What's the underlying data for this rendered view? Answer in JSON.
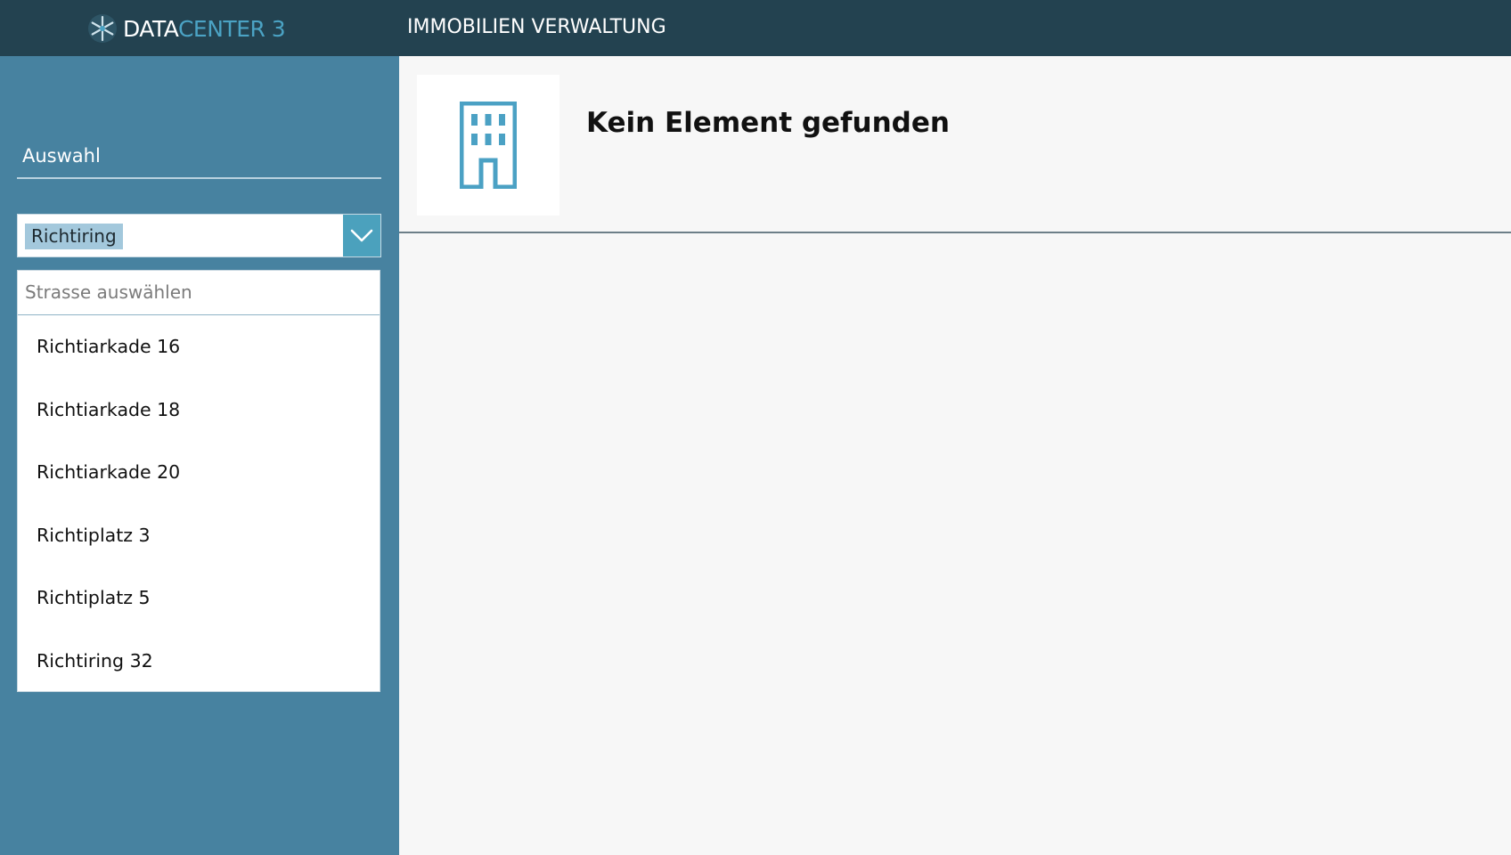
{
  "header": {
    "logo_text_primary": "DATA",
    "logo_text_accent": "CENTER 3",
    "app_title": "IMMOBILIEN VERWALTUNG"
  },
  "sidebar": {
    "section_title": "Auswahl",
    "combo": {
      "selected_value": "Richtiring"
    },
    "dropdown": {
      "search_placeholder": "Strasse auswählen",
      "items": [
        {
          "label": "Richtiarkade 16"
        },
        {
          "label": "Richtiarkade 18"
        },
        {
          "label": "Richtiarkade 20"
        },
        {
          "label": "Richtiplatz 3"
        },
        {
          "label": "Richtiplatz 5"
        },
        {
          "label": "Richtiring 32"
        }
      ]
    }
  },
  "main": {
    "title": "Kein Element gefunden",
    "icon": "building-icon"
  },
  "colors": {
    "topbar": "#234250",
    "sidebar": "#4782a0",
    "accent": "#4ba1bd",
    "selection": "#a3c8dc"
  }
}
